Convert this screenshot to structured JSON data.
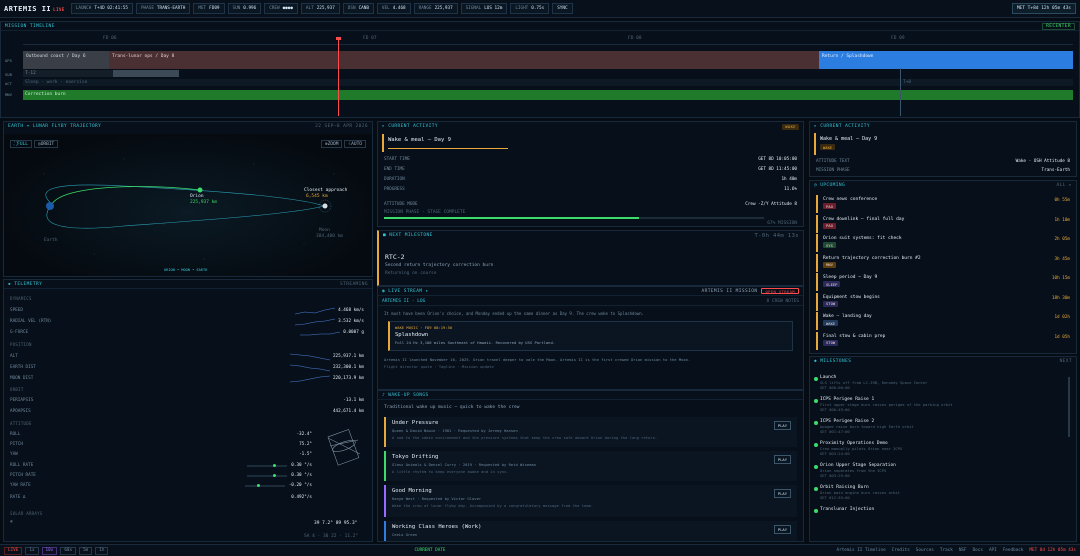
{
  "app": {
    "title": "ARTEMIS II",
    "status": "LIVE"
  },
  "topbar": {
    "chips": [
      {
        "k": "LAUNCH",
        "v": "T+4D 02:41:55"
      },
      {
        "k": "PHASE",
        "v": "TRANS-EARTH"
      },
      {
        "k": "MET",
        "v": "FD09"
      },
      {
        "k": "SUN",
        "v": "0.996"
      },
      {
        "k": "CREW",
        "v": "●●●●"
      },
      {
        "k": "ALT",
        "v": "225,937"
      },
      {
        "k": "DSN",
        "v": "CANB"
      },
      {
        "k": "VEL",
        "v": "4.468"
      },
      {
        "k": "RANGE",
        "v": "225,937"
      },
      {
        "k": "SIGNAL",
        "v": "LOS 12m"
      },
      {
        "k": "LIGHT",
        "v": "0.75s"
      },
      {
        "k": "",
        "v": "SYNC"
      }
    ],
    "met": "MET T+8d 12h 05m 43s"
  },
  "timeline": {
    "title": "MISSION TIMELINE",
    "button": "RECENTER",
    "ticks": [
      "FD 06",
      "FD 07",
      "FD 08",
      "FD 09"
    ],
    "rows": [
      {
        "label": "OPS",
        "bar1": "Outbound coast / Day 6",
        "bar2": "Trans-lunar ops / Day 8",
        "bar3": "Return / Splashdown"
      },
      {
        "label": "SUB",
        "text": "T-12"
      },
      {
        "label": "ACT",
        "text": "Sleep · work · exercise",
        "text2": "T+0"
      },
      {
        "label": "MNV",
        "text": "Correction burn"
      }
    ]
  },
  "trajectory": {
    "title": "EARTH ↔ LUNAR FLYBY TRAJECTORY",
    "right": "22 SEP–8 APR 2026",
    "view_buttons": [
      "FULL",
      "ORBIT"
    ],
    "mode_buttons": [
      "ZOOM",
      "AUTO"
    ],
    "earth_label": "Earth",
    "moon_label": "Moon",
    "orion_label": "Orion",
    "orion_sub": "225,937 km",
    "moon_sub": "384,400 km",
    "closest": "Closest approach",
    "closest_sub": "6,545 km",
    "footer": "ORION • MOON • EARTH"
  },
  "telemetry": {
    "title": "TELEMETRY",
    "right": "STREAMING",
    "dynamics_title": "DYNAMICS",
    "dynamics": [
      {
        "k": "SPEED",
        "v": "4.468 km/s"
      },
      {
        "k": "RADIAL VEL (RTN)",
        "v": "3.532 km/s"
      },
      {
        "k": "G-FORCE",
        "v": "0.0007 g"
      }
    ],
    "position_title": "POSITION",
    "position": [
      {
        "k": "ALT",
        "v": "225,937.1 km"
      },
      {
        "k": "EARTH DIST",
        "v": "232,300.1 km"
      },
      {
        "k": "MOON DIST",
        "v": "220,173.9 km"
      }
    ],
    "orbit_title": "ORBIT",
    "orbit": [
      {
        "k": "PERIAPSIS",
        "v": "-13.1 km"
      },
      {
        "k": "APOAPSIS",
        "v": "442,671.4 km"
      }
    ],
    "attitude_title": "ATTITUDE",
    "attitude": [
      {
        "k": "ROLL",
        "v": "-32.4°"
      },
      {
        "k": "PITCH",
        "v": "75.2°"
      },
      {
        "k": "YAW",
        "v": "-1.5°"
      },
      {
        "k": "ROLL RATE",
        "v": "0.30 °/s"
      },
      {
        "k": "PITCH RATE",
        "v": "0.30 °/s"
      },
      {
        "k": "YAW RATE",
        "v": "-0.20 °/s"
      },
      {
        "k": "RATE Δ",
        "v": "0.492°/s"
      }
    ],
    "solar_title": "SOLAR ARRAYS",
    "solar": {
      "v1": "39 7.2°",
      "v2": "89 95.3°"
    },
    "solar2": "SA 4 · 30 22 · 11.2°"
  },
  "current": {
    "title": "CURRENT ACTIVITY",
    "badge": "WAKE",
    "activity": "Wake & meal – Day 9",
    "rows": [
      {
        "k": "START TIME",
        "v": "GET 8D 10:05:00"
      },
      {
        "k": "END TIME",
        "v": "GET 8D 11:45:00"
      },
      {
        "k": "DURATION",
        "v": "1h 40m"
      },
      {
        "k": "PROGRESS",
        "v": "11.6%"
      }
    ],
    "attitude_k": "ATTITUDE MODE",
    "attitude_v": "Crew -Z/Y Attitude 8",
    "progress_label": "MISSION PHASE · STAGE COMPLETE",
    "progress": 0.67,
    "progress_sub": "67% MISSION"
  },
  "next_milestone": {
    "title": "NEXT MILESTONE",
    "countdown": "T-0h 44m 13s",
    "name": "RTC-2",
    "desc": "Second return trajectory correction burn",
    "sub": "Returning on course"
  },
  "live": {
    "title": "LIVE STREAM",
    "right_label": "ARTEMIS II MISSION",
    "btn": "OPEN STREAM"
  },
  "log": {
    "title": "ARTEMIS II · LOG",
    "right": "8 CREW NOTES",
    "line1": "It must have been Orion's choice, and Monday ended up the same dinner as Day 9. The crew woke to Splashdown.",
    "card_head": "WAKE MUSIC · FD9 08:19:50",
    "card_title": "Splashdown",
    "card_sub": "Full 24 Hz  3,100 miles Southeast of Hawaii. Recovered by USS Portland.",
    "line2": "Artemis II launched November 16, 2025. Orion travel deeper to vale the Moon. Artemis II is the first crewed Orion mission to the Moon.",
    "line3": "Flight director quote  ·  Tagline  ·  Mission update"
  },
  "wakeup": {
    "title": "WAKE-UP SONGS",
    "sub": "Traditional wake up music — quick to wake the crew",
    "songs": [
      {
        "title": "Under Pressure",
        "meta": "Queen & David Bowie · 1981 · Requested by Jeremy Hansen",
        "desc": "A nod to the cabin environment and the pressure systems that keep the crew safe aboard Orion during the long return.",
        "btn": "PLAY"
      },
      {
        "title": "Tokyo Drifting",
        "meta": "Glass Animals & Denzel Curry · 2019 · Requested by Reid Wiseman",
        "desc": "A little rhythm to keep everyone awake and in sync.",
        "btn": "PLAY"
      },
      {
        "title": "Good Morning",
        "meta": "Kanye West · Requested by Victor Glover",
        "desc": "Wake the crew at lunar flyby day. Accompanied by a congratulatory message from the team.",
        "btn": "PLAY"
      },
      {
        "title": "Working Class Heroes (Work)",
        "meta": "CeeLo Green",
        "desc": "",
        "btn": "PLAY"
      }
    ]
  },
  "rcurrent": {
    "title": "CURRENT ACTIVITY",
    "activity": "Wake & meal – Day 9",
    "badge": "WAKE",
    "k1": "ATTITUDE TEXT",
    "v1": "Wake · OSH Attitude 8",
    "k2": "MISSION PHASE",
    "v2": "Trans-Earth"
  },
  "upcoming": {
    "title": "UPCOMING",
    "right": "ALL ▸",
    "items": [
      {
        "t": "Crew news conference",
        "tag": "PAO",
        "tm": "0h 55m"
      },
      {
        "t": "Crew downlink – final full day",
        "tag": "PAO",
        "tm": "1h 10m"
      },
      {
        "t": "Orion suit systems: fit check",
        "tag": "SYS",
        "tm": "2h 05m"
      },
      {
        "t": "Return trajectory correction burn #2",
        "tag": "MNV",
        "tm": "3h 45m"
      },
      {
        "t": "Sleep period – Day 9",
        "tag": "SLEEP",
        "tm": "10h 15m"
      },
      {
        "t": "Equipment stow begins",
        "tag": "STOW",
        "tm": "18h 30m"
      },
      {
        "t": "Wake – landing day",
        "tag": "WAKE",
        "tm": "1d 02h"
      },
      {
        "t": "Final stow & cabin prep",
        "tag": "STOW",
        "tm": "1d 05h"
      }
    ]
  },
  "milestones": {
    "title": "MILESTONES",
    "right": "NEXT",
    "items": [
      {
        "t": "Launch",
        "d": "SLS lifts off from LC-39B, Kennedy Space Center",
        "g": "GET 000:00:00"
      },
      {
        "t": "ICPS Perigee Raise 1",
        "d": "First upper stage burn raises perigee of the parking orbit",
        "g": "GET 000:49:00"
      },
      {
        "t": "ICPS Perigee Raise 2",
        "d": "Apogee raise burn toward high Earth orbit",
        "g": "GET 001:47:00"
      },
      {
        "t": "Proximity Operations Demo",
        "d": "Crew manually pilots Orion near ICPS",
        "g": "GET 003:24:00"
      },
      {
        "t": "Orion Upper Stage Separation",
        "d": "Orion separates from the ICPS",
        "g": "GET 003:29:00"
      },
      {
        "t": "Orbit Raising Burn",
        "d": "Orion main engine burn raises orbit",
        "g": "GET 012:55:00"
      },
      {
        "t": "Translunar Injection",
        "d": "",
        "g": ""
      }
    ]
  },
  "bottombar": {
    "left": [
      "LIVE",
      "1x",
      "10x",
      "60x",
      "5m",
      "1h"
    ],
    "center": "CURRENT DATE",
    "links": [
      "Artemis II Timeline",
      "Credits",
      "Sources",
      "Track",
      "NSF",
      "Docs",
      "API",
      "Feedback"
    ],
    "right": "MET 8d 12h 05m 43s"
  },
  "colors": {
    "accent": "#33c4d8",
    "green": "#3ddc6a",
    "amber": "#e8a93a",
    "red": "#ff4b4b",
    "purple": "#9b6bff",
    "blue": "#2f7de0"
  }
}
